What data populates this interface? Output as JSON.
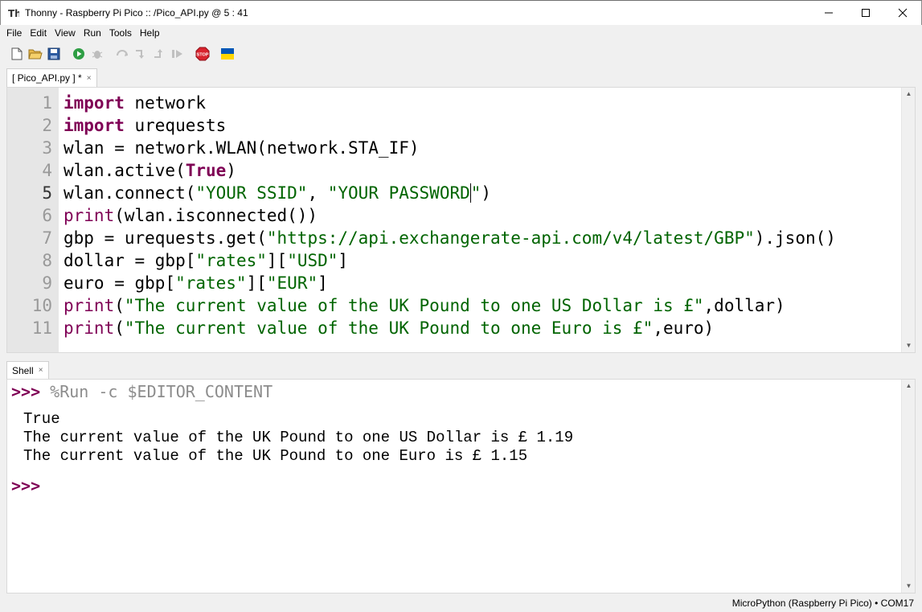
{
  "window": {
    "title": "Thonny  -  Raspberry Pi Pico :: /Pico_API.py  @  5 : 41",
    "minimize_glyph": "—",
    "maximize_glyph": "☐",
    "close_glyph": "✕"
  },
  "menu": [
    "File",
    "Edit",
    "View",
    "Run",
    "Tools",
    "Help"
  ],
  "toolbar": {
    "icons": [
      "new-file-icon",
      "open-file-icon",
      "save-icon",
      "run-icon",
      "debug-icon",
      "step-over-icon",
      "step-into-icon",
      "step-out-icon",
      "resume-icon",
      "stop-icon",
      "ukraine-flag-icon"
    ],
    "stop_label": "STOP",
    "colors": {
      "run": "#2e9e44",
      "stop": "#d9232d",
      "flag_blue": "#0057b7",
      "flag_yellow": "#ffd700"
    }
  },
  "editor": {
    "tab_label": "[ Pico_API.py ] *",
    "tab_close": "×",
    "line_numbers": [
      "1",
      "2",
      "3",
      "4",
      "5",
      "6",
      "7",
      "8",
      "9",
      "10",
      "11"
    ],
    "lines": [
      [
        {
          "t": "import",
          "c": "kw"
        },
        {
          "t": " network",
          "c": ""
        }
      ],
      [
        {
          "t": "import",
          "c": "kw"
        },
        {
          "t": " urequests",
          "c": ""
        }
      ],
      [
        {
          "t": "wlan = network.WLAN(network.STA_IF)",
          "c": ""
        }
      ],
      [
        {
          "t": "wlan.active(",
          "c": ""
        },
        {
          "t": "True",
          "c": "kw"
        },
        {
          "t": ")",
          "c": ""
        }
      ],
      [
        {
          "t": "wlan.connect(",
          "c": ""
        },
        {
          "t": "\"YOUR SSID\"",
          "c": "str"
        },
        {
          "t": ", ",
          "c": ""
        },
        {
          "t": "\"YOUR PASSWORD",
          "c": "str"
        },
        {
          "t": "\"",
          "c": "str cur"
        },
        {
          "t": ")",
          "c": ""
        }
      ],
      [
        {
          "t": "print",
          "c": "bi"
        },
        {
          "t": "(wlan.isconnected())",
          "c": ""
        }
      ],
      [
        {
          "t": "gbp = urequests.get(",
          "c": ""
        },
        {
          "t": "\"https://api.exchangerate-api.com/v4/latest/GBP\"",
          "c": "str"
        },
        {
          "t": ").json()",
          "c": ""
        }
      ],
      [
        {
          "t": "dollar = gbp[",
          "c": ""
        },
        {
          "t": "\"rates\"",
          "c": "str"
        },
        {
          "t": "][",
          "c": ""
        },
        {
          "t": "\"USD\"",
          "c": "str"
        },
        {
          "t": "]",
          "c": ""
        }
      ],
      [
        {
          "t": "euro = gbp[",
          "c": ""
        },
        {
          "t": "\"rates\"",
          "c": "str"
        },
        {
          "t": "][",
          "c": ""
        },
        {
          "t": "\"EUR\"",
          "c": "str"
        },
        {
          "t": "]",
          "c": ""
        }
      ],
      [
        {
          "t": "print",
          "c": "bi"
        },
        {
          "t": "(",
          "c": ""
        },
        {
          "t": "\"The current value of the UK Pound to one US Dollar is £\"",
          "c": "str"
        },
        {
          "t": ",dollar)",
          "c": ""
        }
      ],
      [
        {
          "t": "print",
          "c": "bi"
        },
        {
          "t": "(",
          "c": ""
        },
        {
          "t": "\"The current value of the UK Pound to one Euro is £\"",
          "c": "str"
        },
        {
          "t": ",euro)",
          "c": ""
        }
      ]
    ],
    "current_line": "5"
  },
  "shell": {
    "tab_label": "Shell",
    "tab_close": "×",
    "prompt": ">>>",
    "command": " %Run -c $EDITOR_CONTENT",
    "output": [
      "True",
      "The current value of the UK Pound to one US Dollar is £ 1.19",
      "The current value of the UK Pound to one Euro is £ 1.15"
    ],
    "final_prompt": ">>>"
  },
  "statusbar": {
    "interpreter": "MicroPython (Raspberry Pi Pico)  •  COM17"
  }
}
